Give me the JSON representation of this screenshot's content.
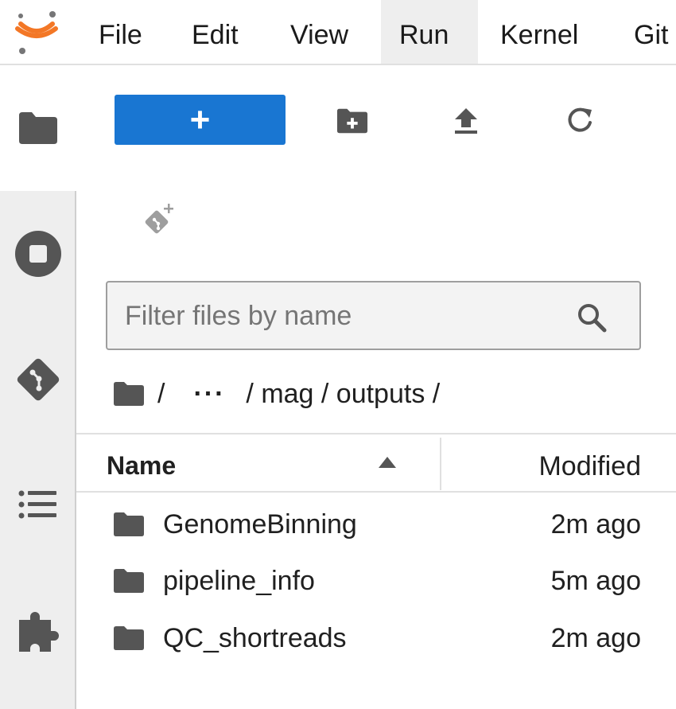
{
  "menubar": {
    "items": [
      {
        "label": "File"
      },
      {
        "label": "Edit"
      },
      {
        "label": "View"
      },
      {
        "label": "Run",
        "active": true
      },
      {
        "label": "Kernel"
      },
      {
        "label": "Git"
      }
    ]
  },
  "activity_bar": {
    "tabs": [
      {
        "icon": "folder-icon",
        "selected": true
      },
      {
        "icon": "stop-circle-icon"
      },
      {
        "icon": "git-icon"
      },
      {
        "icon": "list-icon"
      },
      {
        "icon": "puzzle-icon"
      }
    ]
  },
  "toolbar": {
    "new_button_label": "+",
    "icons": [
      "new-folder-icon",
      "upload-icon",
      "refresh-icon",
      "git-clone-icon"
    ]
  },
  "filter": {
    "placeholder": "Filter files by name",
    "value": ""
  },
  "breadcrumbs": {
    "sep1": "/",
    "ellipsis": "···",
    "path": "/ mag / outputs /"
  },
  "file_list": {
    "headers": {
      "name": "Name",
      "modified": "Modified"
    },
    "sort": "ascending",
    "rows": [
      {
        "name": "GenomeBinning",
        "modified": "2m ago",
        "type": "folder"
      },
      {
        "name": "pipeline_info",
        "modified": "5m ago",
        "type": "folder"
      },
      {
        "name": "QC_shortreads",
        "modified": "2m ago",
        "type": "folder"
      }
    ]
  },
  "colors": {
    "accent": "#1976d2",
    "logo_orange": "#f37726",
    "icon_gray": "#555555"
  }
}
